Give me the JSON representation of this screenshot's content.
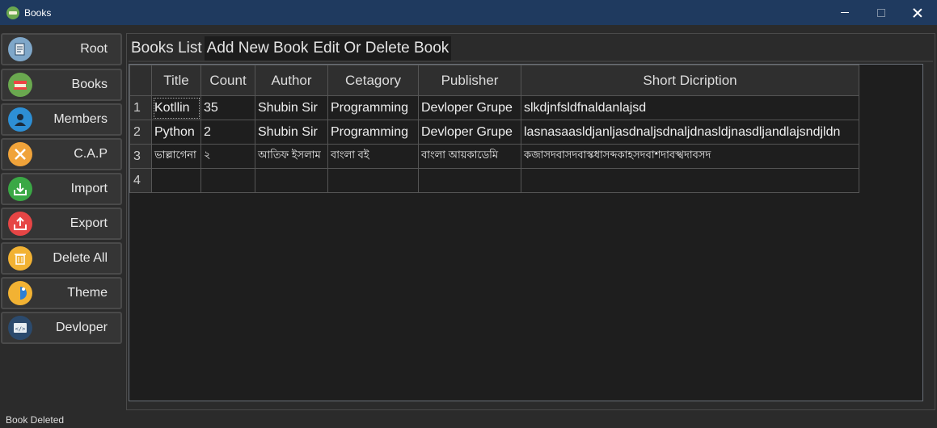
{
  "window": {
    "title": "Books",
    "icon": "books-app-icon"
  },
  "sidebar": {
    "items": [
      {
        "label": "Root",
        "icon": "root-notepad-icon",
        "color": "#7fa7c9"
      },
      {
        "label": "Books",
        "icon": "books-stack-icon",
        "color": "#6aa84f"
      },
      {
        "label": "Members",
        "icon": "member-person-icon",
        "color": "#2d8fd5"
      },
      {
        "label": "C.A.P",
        "icon": "tools-icon",
        "color": "#f0a33a"
      },
      {
        "label": "Import",
        "icon": "import-download-icon",
        "color": "#3aa845"
      },
      {
        "label": "Export",
        "icon": "export-upload-icon",
        "color": "#e64545"
      },
      {
        "label": "Delete All",
        "icon": "trash-icon",
        "color": "#f2b233"
      },
      {
        "label": "Theme",
        "icon": "theme-icon",
        "color": "#f2b233"
      },
      {
        "label": "Devloper",
        "icon": "code-icon",
        "color": "#2b4a6d"
      }
    ]
  },
  "tabs": [
    {
      "label": "Books List",
      "active": true
    },
    {
      "label": "Add New Book",
      "active": false
    },
    {
      "label": "Edit Or Delete Book",
      "active": false
    }
  ],
  "table": {
    "headers": [
      "Title",
      "Count",
      "Author",
      "Cetagory",
      "Publisher",
      "Short Dicription"
    ],
    "rows": [
      {
        "num": "1",
        "cells": [
          "Kotllin",
          "35",
          "Shubin Sir",
          "Programming",
          "Devloper Grupe",
          "slkdjnfsldfnaldanlajsd"
        ]
      },
      {
        "num": "2",
        "cells": [
          "Python",
          "2",
          "Shubin Sir",
          "Programming",
          "Devloper Grupe",
          "lasnasaasldjanljasdnaljsdnaljdnasldjnasdljandlajsndjldn"
        ]
      },
      {
        "num": "3",
        "cells": [
          "ভাল্লাগেনা",
          "২",
          "আতিফ ইসলাম",
          "বাংলা বই",
          "বাংলা আয়কাডেমি",
          "কজাসদবাসদবাস্কধাসব্দকাহসদবাশদাবস্খদাবসদ"
        ]
      },
      {
        "num": "4",
        "cells": [
          "",
          "",
          "",
          "",
          "",
          ""
        ]
      }
    ]
  },
  "status": {
    "text": "Book Deleted"
  }
}
